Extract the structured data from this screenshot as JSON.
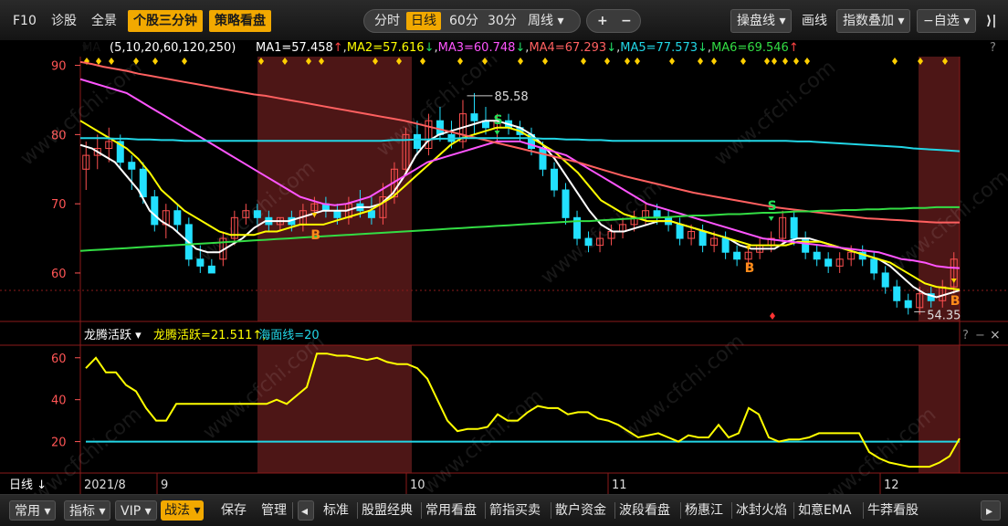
{
  "toolbar": {
    "f10": "F10",
    "diagnose": "诊股",
    "panorama": "全景",
    "stock_3min": "个股三分钟",
    "strategy": "策略看盘",
    "timeshare": "分时",
    "daily": "日线",
    "min60": "60分",
    "min30": "30分",
    "weekly": "周线",
    "plus": "+",
    "minus": "−",
    "trade_line": "操盘线",
    "draw": "画线",
    "index_overlay": "指数叠加",
    "watchlist": "自选",
    "exit": "⟩|"
  },
  "ma_bar": {
    "indicator": "MA",
    "params": "(5,10,20,60,120,250)",
    "items": [
      {
        "label": "MA1=57.458",
        "arrow": "↑",
        "color": "#ffffff"
      },
      {
        "label": "MA2=57.616",
        "arrow": "↓",
        "color": "#ffff00"
      },
      {
        "label": "MA3=60.748",
        "arrow": "↓",
        "color": "#ff55ff"
      },
      {
        "label": "MA4=67.293",
        "arrow": "↓",
        "color": "#ff6060"
      },
      {
        "label": "MA5=77.573",
        "arrow": "↓",
        "color": "#22d6e6"
      },
      {
        "label": "MA6=69.546",
        "arrow": "↑",
        "color": "#33dd44"
      }
    ],
    "help": "?"
  },
  "sub_bar": {
    "indicator": "龙腾活跃",
    "items": [
      {
        "label": "龙腾活跃=21.511",
        "arrow": "↑",
        "color": "#ffff00"
      },
      {
        "label": "海面线=20",
        "arrow": "",
        "color": "#22d6e6"
      }
    ],
    "help": "?",
    "minimize": "−",
    "close": "×"
  },
  "xaxis": {
    "period": "日线",
    "labels": [
      "2021/8",
      "9",
      "10",
      "11",
      "12"
    ]
  },
  "bottom_bar": {
    "tabs": [
      "常用",
      "指标",
      "VIP",
      "战法"
    ],
    "active_tab": "战法",
    "actions": [
      "保存",
      "管理"
    ],
    "indicators": [
      "标准",
      "股盟经典",
      "常用看盘",
      "箭指买卖",
      "散户资金",
      "波段看盘",
      "杨惠江",
      "冰封火焰",
      "如意EMA",
      "牛莽看股"
    ]
  },
  "watermark": "www.cfchi.com",
  "chart_data": [
    {
      "type": "candlestick",
      "title": "",
      "ylabel": "",
      "y_ticks": [
        90,
        80,
        70,
        60
      ],
      "ylim": [
        53,
        91
      ],
      "annotations": {
        "high": "85.58",
        "low": "54.35",
        "buy": "B",
        "sell": "S"
      },
      "candles": [
        [
          75,
          79,
          72,
          77
        ],
        [
          77,
          80,
          75,
          78
        ],
        [
          78,
          81,
          76,
          79
        ],
        [
          79,
          80,
          75,
          76
        ],
        [
          76,
          77,
          72,
          75
        ],
        [
          75,
          76,
          70,
          71
        ],
        [
          71,
          72,
          66,
          67
        ],
        [
          67,
          70,
          65,
          69
        ],
        [
          69,
          70,
          66,
          67
        ],
        [
          67,
          68,
          61,
          62
        ],
        [
          62,
          64,
          60,
          61
        ],
        [
          61,
          62,
          60,
          60
        ],
        [
          62,
          66,
          61,
          65
        ],
        [
          65,
          69,
          64,
          68
        ],
        [
          68,
          70,
          67,
          69
        ],
        [
          69,
          70,
          67,
          68
        ],
        [
          68,
          69,
          66,
          67
        ],
        [
          67,
          68,
          66,
          68
        ],
        [
          68,
          69,
          66,
          67
        ],
        [
          67,
          70,
          66,
          69
        ],
        [
          69,
          71,
          68,
          70
        ],
        [
          70,
          71,
          68,
          69
        ],
        [
          69,
          70,
          67,
          68
        ],
        [
          68,
          71,
          67,
          70
        ],
        [
          70,
          72,
          68,
          69
        ],
        [
          69,
          71,
          67,
          68
        ],
        [
          68,
          73,
          67,
          71
        ],
        [
          71,
          76,
          70,
          75
        ],
        [
          75,
          81,
          74,
          80
        ],
        [
          80,
          82,
          77,
          78
        ],
        [
          78,
          83,
          77,
          82
        ],
        [
          82,
          84,
          79,
          80
        ],
        [
          80,
          82,
          78,
          79
        ],
        [
          79,
          85,
          78,
          83
        ],
        [
          83,
          86,
          80,
          82
        ],
        [
          82,
          84,
          80,
          81
        ],
        [
          81,
          83,
          79,
          82
        ],
        [
          82,
          83,
          80,
          81
        ],
        [
          81,
          82,
          79,
          80
        ],
        [
          80,
          81,
          77,
          78
        ],
        [
          78,
          79,
          74,
          75
        ],
        [
          75,
          76,
          71,
          72
        ],
        [
          72,
          73,
          67,
          68
        ],
        [
          68,
          69,
          64,
          65
        ],
        [
          65,
          66,
          63,
          64
        ],
        [
          64,
          66,
          63,
          65
        ],
        [
          65,
          67,
          64,
          66
        ],
        [
          66,
          68,
          65,
          67
        ],
        [
          67,
          69,
          66,
          68
        ],
        [
          68,
          70,
          67,
          69
        ],
        [
          69,
          70,
          67,
          68
        ],
        [
          68,
          69,
          66,
          67
        ],
        [
          67,
          68,
          64,
          65
        ],
        [
          65,
          67,
          64,
          66
        ],
        [
          66,
          67,
          63,
          64
        ],
        [
          64,
          66,
          63,
          65
        ],
        [
          65,
          66,
          62,
          63
        ],
        [
          63,
          64,
          61,
          62
        ],
        [
          62,
          64,
          61,
          63
        ],
        [
          63,
          65,
          62,
          64
        ],
        [
          64,
          66,
          63,
          65
        ],
        [
          65,
          69,
          64,
          68
        ],
        [
          68,
          69,
          64,
          65
        ],
        [
          65,
          66,
          62,
          63
        ],
        [
          63,
          64,
          61,
          62
        ],
        [
          62,
          63,
          60,
          61
        ],
        [
          61,
          63,
          60,
          62
        ],
        [
          62,
          64,
          61,
          63
        ],
        [
          63,
          64,
          61,
          62
        ],
        [
          62,
          63,
          59,
          60
        ],
        [
          60,
          61,
          57,
          58
        ],
        [
          58,
          59,
          55,
          56
        ],
        [
          56,
          57,
          54,
          55
        ],
        [
          55,
          58,
          54,
          57
        ],
        [
          57,
          58,
          55,
          56
        ],
        [
          56,
          59,
          55,
          58
        ],
        [
          58,
          63,
          57,
          62
        ]
      ],
      "series": [
        {
          "name": "MA1",
          "color": "#ffffff",
          "values": [
            78.5,
            78,
            77,
            76,
            74,
            72,
            69,
            67.5,
            66.5,
            65,
            63.5,
            63,
            63,
            64,
            65,
            66.5,
            67.5,
            67.5,
            67.5,
            68,
            68.5,
            69,
            69,
            69,
            69.5,
            69.5,
            70,
            71.5,
            74,
            77,
            79,
            80,
            80.5,
            81,
            81.5,
            82,
            82,
            81.5,
            81,
            80,
            78.5,
            76.5,
            74,
            71.5,
            69,
            67,
            66,
            66,
            66.5,
            67,
            67.5,
            67.5,
            67,
            66.5,
            66,
            65.5,
            65,
            64,
            63.5,
            63.5,
            63.5,
            64.5,
            65,
            65,
            64.5,
            64,
            63.5,
            63,
            62.5,
            62,
            61,
            59.5,
            58,
            57,
            56.5,
            57,
            57.5
          ]
        },
        {
          "name": "MA2",
          "color": "#ffff00",
          "values": [
            82,
            81,
            80,
            79,
            78,
            76.5,
            74.5,
            72,
            70.5,
            69,
            68,
            67,
            66,
            65.5,
            65.5,
            65.5,
            66,
            66,
            66.5,
            67,
            67,
            67,
            67.5,
            68,
            68.5,
            69,
            70,
            71,
            72.5,
            74,
            75.5,
            77,
            78.5,
            79.5,
            80,
            80.5,
            81,
            81,
            80.5,
            79.5,
            78.5,
            77.5,
            76,
            74.5,
            72.5,
            70.5,
            69.5,
            68.5,
            68,
            67.5,
            67.5,
            67.5,
            67,
            66.5,
            66,
            65.5,
            65,
            64.5,
            64,
            64,
            64,
            64,
            64.5,
            64.5,
            64.5,
            64,
            63.5,
            63,
            62.5,
            62,
            61.5,
            60.5,
            59.5,
            58.5,
            58,
            57.8,
            57.6
          ]
        },
        {
          "name": "MA3",
          "color": "#ff55ff",
          "values": [
            88,
            87.5,
            87,
            86.5,
            86,
            85,
            84,
            83,
            82,
            81,
            80,
            79,
            78,
            77,
            76,
            75,
            74,
            73,
            72,
            71,
            70.5,
            70,
            69.8,
            70,
            70.5,
            71,
            72,
            73,
            74,
            75,
            76,
            76.5,
            77,
            77.5,
            78,
            78.5,
            79,
            79,
            79,
            78.5,
            78,
            77.5,
            77,
            76,
            75,
            74,
            73,
            72,
            71,
            70,
            69.5,
            69,
            68.5,
            68,
            67.5,
            67,
            66.5,
            66,
            65.5,
            65,
            64.8,
            64.6,
            64.4,
            64.2,
            64,
            63.8,
            63.6,
            63.4,
            63.2,
            63,
            62.5,
            62,
            61.8,
            61.5,
            61,
            60.8,
            60.7
          ]
        },
        {
          "name": "MA4",
          "color": "#ff6060",
          "values": [
            90.5,
            90.2,
            89.8,
            89.5,
            89.2,
            88.8,
            88.5,
            88.2,
            87.9,
            87.6,
            87.3,
            87,
            86.7,
            86.4,
            86.1,
            85.8,
            85.6,
            85.3,
            85,
            84.7,
            84.4,
            84.1,
            83.8,
            83.5,
            83.2,
            82.9,
            82.6,
            82.3,
            82,
            81.6,
            81.2,
            80.8,
            80.4,
            80,
            79.6,
            79.2,
            78.8,
            78.4,
            78,
            77.6,
            77.2,
            76.8,
            76.4,
            76,
            75.5,
            75,
            74.5,
            74,
            73.6,
            73.2,
            72.8,
            72.4,
            72,
            71.6,
            71.3,
            71,
            70.7,
            70.4,
            70.1,
            69.8,
            69.5,
            69.3,
            69.1,
            68.9,
            68.7,
            68.5,
            68.3,
            68.1,
            67.9,
            67.8,
            67.7,
            67.6,
            67.5,
            67.4,
            67.3,
            67.3,
            67.3
          ]
        },
        {
          "name": "MA5",
          "color": "#22d6e6",
          "values": [
            79.5,
            79.5,
            79.5,
            79.4,
            79.4,
            79.3,
            79.3,
            79.2,
            79.2,
            79.1,
            79.1,
            79.1,
            79.1,
            79.1,
            79.1,
            79.1,
            79.1,
            79.1,
            79.1,
            79.1,
            79.1,
            79.1,
            79.1,
            79.1,
            79.1,
            79.1,
            79.1,
            79.2,
            79.2,
            79.3,
            79.3,
            79.4,
            79.4,
            79.5,
            79.5,
            79.5,
            79.5,
            79.5,
            79.5,
            79.5,
            79.4,
            79.4,
            79.3,
            79.3,
            79.2,
            79.2,
            79.1,
            79.1,
            79.1,
            79.1,
            79.1,
            79.1,
            79.1,
            79.1,
            79.1,
            79.1,
            79.1,
            79.1,
            79.1,
            79.1,
            79.1,
            79.1,
            79,
            79,
            78.9,
            78.8,
            78.7,
            78.6,
            78.5,
            78.4,
            78.3,
            78.2,
            78,
            77.9,
            77.8,
            77.7,
            77.6
          ]
        },
        {
          "name": "MA6",
          "color": "#33dd44",
          "values": [
            63.2,
            63.3,
            63.4,
            63.5,
            63.6,
            63.7,
            63.8,
            63.9,
            64,
            64.1,
            64.2,
            64.3,
            64.4,
            64.5,
            64.6,
            64.7,
            64.8,
            64.9,
            65,
            65.1,
            65.2,
            65.3,
            65.4,
            65.5,
            65.6,
            65.7,
            65.8,
            65.9,
            66,
            66.1,
            66.2,
            66.3,
            66.4,
            66.5,
            66.6,
            66.7,
            66.8,
            66.9,
            67,
            67.1,
            67.2,
            67.3,
            67.4,
            67.5,
            67.5,
            67.6,
            67.7,
            67.8,
            67.9,
            68,
            68,
            68.1,
            68.2,
            68.3,
            68.3,
            68.4,
            68.5,
            68.5,
            68.6,
            68.7,
            68.7,
            68.8,
            68.9,
            68.9,
            69,
            69,
            69.1,
            69.1,
            69.2,
            69.2,
            69.3,
            69.3,
            69.4,
            69.4,
            69.5,
            69.5,
            69.5
          ]
        }
      ]
    },
    {
      "type": "line",
      "title": "",
      "y_ticks": [
        60,
        40,
        20
      ],
      "ylim": [
        5,
        66
      ],
      "series": [
        {
          "name": "龙腾活跃",
          "color": "#ffff00",
          "values": [
            55,
            60,
            53,
            53,
            47,
            44,
            36,
            30,
            30,
            38,
            38,
            38,
            38,
            38,
            38,
            38,
            38,
            38,
            38,
            40,
            38,
            42,
            46,
            62,
            62,
            61,
            61,
            60,
            59,
            60,
            58,
            57,
            57,
            55,
            50,
            40,
            30,
            25,
            26,
            26,
            27,
            33,
            30,
            30,
            34,
            37,
            36,
            36,
            33,
            34,
            34,
            31,
            30,
            28,
            25,
            22,
            23,
            24,
            22,
            20,
            23,
            22,
            22,
            28,
            22,
            24,
            36,
            33,
            22,
            20,
            21,
            21,
            22,
            24,
            24,
            24,
            24,
            24,
            15,
            12,
            10,
            9,
            8,
            8,
            8,
            10,
            13,
            21.5
          ]
        },
        {
          "name": "海面线",
          "color": "#22d6e6",
          "values": [
            20
          ]
        }
      ]
    }
  ]
}
